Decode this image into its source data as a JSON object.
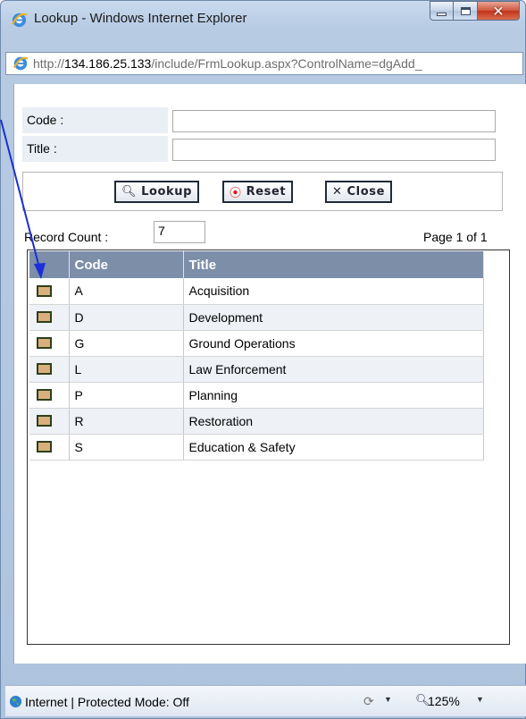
{
  "window": {
    "title": "Lookup - Windows Internet Explorer",
    "address_prefix": "http://",
    "address_host": "134.186.25.133",
    "address_path": "/include/FrmLookup.aspx?ControlName=dgAdd_"
  },
  "form": {
    "code_label": "Code :",
    "code_value": "",
    "title_label": "Title :",
    "title_value": ""
  },
  "buttons": {
    "lookup_label": "Lookup",
    "reset_label": "Reset",
    "close_label": "Close"
  },
  "records": {
    "count_label": "Record Count :",
    "count_value": "7",
    "page_info": "Page 1 of 1"
  },
  "grid": {
    "headers": [
      "",
      "Code",
      "Title"
    ],
    "rows": [
      {
        "code": "A",
        "title": "Acquisition"
      },
      {
        "code": "D",
        "title": "Development"
      },
      {
        "code": "G",
        "title": "Ground Operations"
      },
      {
        "code": "L",
        "title": "Law Enforcement"
      },
      {
        "code": "P",
        "title": "Planning"
      },
      {
        "code": "R",
        "title": "Restoration"
      },
      {
        "code": "S",
        "title": "Education & Safety"
      }
    ]
  },
  "status": {
    "zone_text": "Internet | Protected Mode: Off",
    "zoom": "125%"
  },
  "colors": {
    "grid_header": "#7d8ea9",
    "alt_row": "#eef1f6",
    "select_box": "#d9b07d",
    "annotation_arrow": "#1a2fd8"
  },
  "icons": {
    "lookup": "magnifier-icon",
    "reset": "target-icon",
    "close": "x-icon",
    "browser": "ie-logo-icon",
    "status": "globe-icon"
  }
}
